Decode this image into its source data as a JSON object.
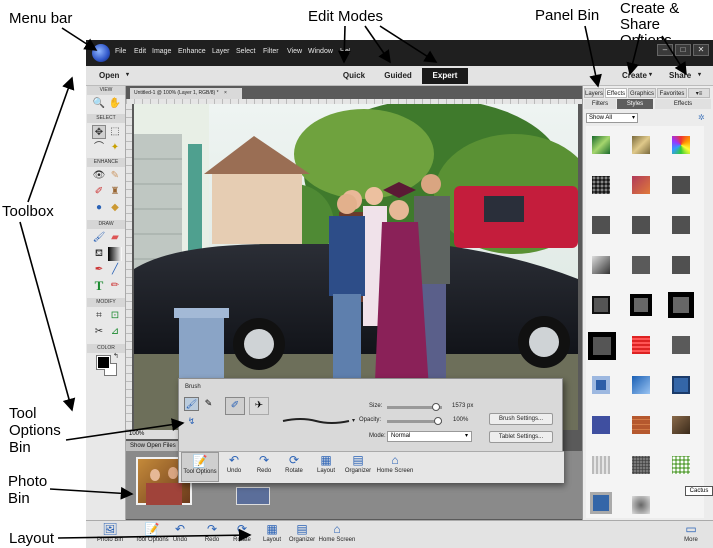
{
  "callouts": {
    "menu_bar": "Menu bar",
    "edit_modes": "Edit Modes",
    "panel_bin": "Panel Bin",
    "create_share": "Create &\nShare Options",
    "toolbox": "Toolbox",
    "tool_options_bin": "Tool\nOptions\nBin",
    "photo_bin": "Photo\nBin",
    "layout": "Layout"
  },
  "menu": [
    "File",
    "Edit",
    "Image",
    "Enhance",
    "Layer",
    "Select",
    "Filter",
    "View",
    "Window",
    "Help"
  ],
  "modebar": {
    "open": "Open",
    "modes": [
      "Quick",
      "Guided",
      "Expert"
    ],
    "active_mode": "Expert",
    "create": "Create",
    "share": "Share"
  },
  "toolbox": {
    "sections": [
      "VIEW",
      "SELECT",
      "ENHANCE",
      "DRAW",
      "MODIFY",
      "COLOR"
    ]
  },
  "document": {
    "tab": "Untitled-1 @ 100% (Layer 1, RGB/8) *",
    "zoom": "100%"
  },
  "photo_bin": {
    "show_open_files": "Show Open Files"
  },
  "panel": {
    "tabs": [
      "Layers",
      "Effects",
      "Graphics",
      "Favorites"
    ],
    "active_tab": "Effects",
    "subtabs": [
      "Filters",
      "Styles",
      "Effects"
    ],
    "active_subtab": "Styles",
    "dropdown": "Show All",
    "tooltip": "Cactus"
  },
  "tool_options": {
    "title": "Brush",
    "size_label": "Size:",
    "size_value": "1573 px",
    "size_level": 0.96,
    "opacity_label": "Opacity:",
    "opacity_value": "100%",
    "opacity_level": 1.0,
    "mode_label": "Mode:",
    "mode_value": "Normal",
    "brush_settings": "Brush Settings...",
    "tablet_settings": "Tablet Settings...",
    "buttons": [
      "Tool Options",
      "Undo",
      "Redo",
      "Rotate",
      "Layout",
      "Organizer",
      "Home Screen"
    ]
  },
  "taskbar": {
    "buttons": [
      "Photo Bin",
      "Tool Options",
      "Undo",
      "Redo",
      "Rotate",
      "Layout",
      "Organizer",
      "Home Screen"
    ],
    "more": "More"
  },
  "colors": {
    "menubar_bg": "#1f1f1f",
    "active_mode_bg": "#1a1a1a",
    "workspace_bg": "#5a5a5a",
    "accent_blue": "#2a62b6"
  }
}
